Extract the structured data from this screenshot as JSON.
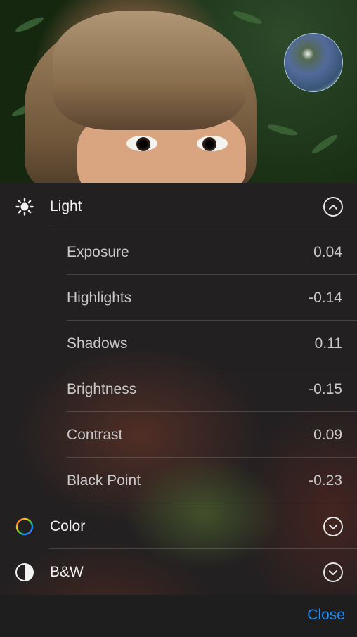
{
  "sections": {
    "light": {
      "label": "Light",
      "icon": "sun-icon",
      "expanded": true
    },
    "color": {
      "label": "Color",
      "icon": "color-ring-icon",
      "expanded": false
    },
    "bw": {
      "label": "B&W",
      "icon": "half-circle-icon",
      "expanded": false
    }
  },
  "adjustments": [
    {
      "label": "Exposure",
      "value": "0.04"
    },
    {
      "label": "Highlights",
      "value": "-0.14"
    },
    {
      "label": "Shadows",
      "value": "0.11"
    },
    {
      "label": "Brightness",
      "value": "-0.15"
    },
    {
      "label": "Contrast",
      "value": "0.09"
    },
    {
      "label": "Black Point",
      "value": "-0.23"
    }
  ],
  "footer": {
    "close_label": "Close"
  },
  "colors": {
    "accent": "#1f8ef5"
  }
}
